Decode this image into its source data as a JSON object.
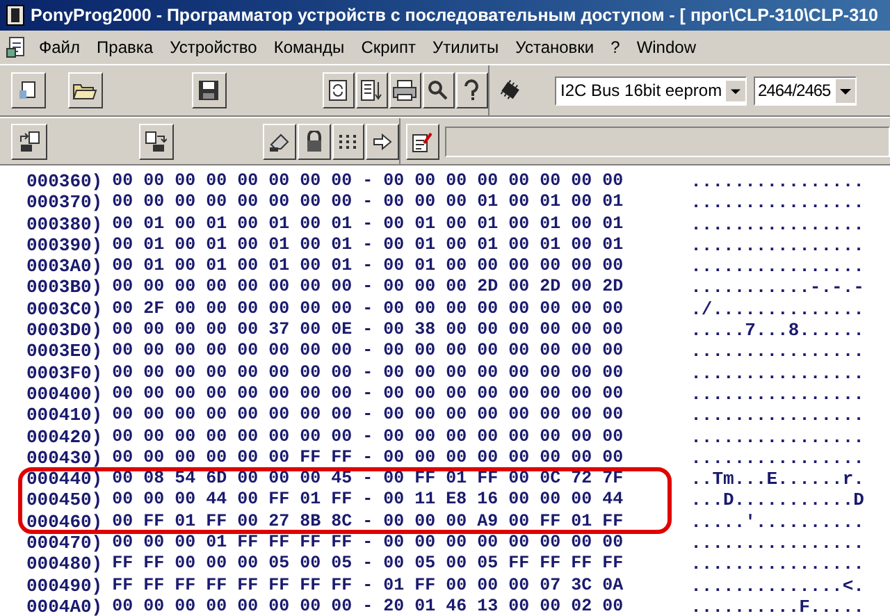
{
  "window": {
    "title": "PonyProg2000 - Программатор устройств с последовательным доступом - [ прог\\CLP-310\\CLP-310"
  },
  "menu": [
    "Файл",
    "Правка",
    "Устройство",
    "Команды",
    "Скрипт",
    "Утилиты",
    "Установки",
    "?",
    "Window"
  ],
  "device_family": "I2C Bus 16bit eeprom",
  "device_type": "2464/2465",
  "rows": [
    {
      "address": "000360)",
      "hex": "00 00 00 00 00 00 00 00 - 00 00 00 00 00 00 00 00",
      "ascii": "................",
      "highlighted": false
    },
    {
      "address": "000370)",
      "hex": "00 00 00 00 00 00 00 00 - 00 00 00 01 00 01 00 01",
      "ascii": "................",
      "highlighted": false
    },
    {
      "address": "000380)",
      "hex": "00 01 00 01 00 01 00 01 - 00 01 00 01 00 01 00 01",
      "ascii": "................",
      "highlighted": false
    },
    {
      "address": "000390)",
      "hex": "00 01 00 01 00 01 00 01 - 00 01 00 01 00 01 00 01",
      "ascii": "................",
      "highlighted": false
    },
    {
      "address": "0003A0)",
      "hex": "00 01 00 01 00 01 00 01 - 00 01 00 00 00 00 00 00",
      "ascii": "................",
      "highlighted": false
    },
    {
      "address": "0003B0)",
      "hex": "00 00 00 00 00 00 00 00 - 00 00 00 2D 00 2D 00 2D",
      "ascii": "...........-.-.-",
      "highlighted": false
    },
    {
      "address": "0003C0)",
      "hex": "00 2F 00 00 00 00 00 00 - 00 00 00 00 00 00 00 00",
      "ascii": "./..............",
      "highlighted": false
    },
    {
      "address": "0003D0)",
      "hex": "00 00 00 00 00 37 00 0E - 00 38 00 00 00 00 00 00",
      "ascii": ".....7...8......",
      "highlighted": false
    },
    {
      "address": "0003E0)",
      "hex": "00 00 00 00 00 00 00 00 - 00 00 00 00 00 00 00 00",
      "ascii": "................",
      "highlighted": false
    },
    {
      "address": "0003F0)",
      "hex": "00 00 00 00 00 00 00 00 - 00 00 00 00 00 00 00 00",
      "ascii": "................",
      "highlighted": false
    },
    {
      "address": "000400)",
      "hex": "00 00 00 00 00 00 00 00 - 00 00 00 00 00 00 00 00",
      "ascii": "................",
      "highlighted": false
    },
    {
      "address": "000410)",
      "hex": "00 00 00 00 00 00 00 00 - 00 00 00 00 00 00 00 00",
      "ascii": "................",
      "highlighted": false
    },
    {
      "address": "000420)",
      "hex": "00 00 00 00 00 00 00 00 - 00 00 00 00 00 00 00 00",
      "ascii": "................",
      "highlighted": false
    },
    {
      "address": "000430)",
      "hex": "00 00 00 00 00 00 FF FF - 00 00 00 00 00 00 00 00",
      "ascii": "................",
      "highlighted": false
    },
    {
      "address": "000440)",
      "hex": "00 08 54 6D 00 00 00 45 - 00 FF 01 FF 00 0C 72 7F",
      "ascii": "..Tm...E......r.",
      "highlighted": true
    },
    {
      "address": "000450)",
      "hex": "00 00 00 44 00 FF 01 FF - 00 11 E8 16 00 00 00 44",
      "ascii": "...D...........D",
      "highlighted": true
    },
    {
      "address": "000460)",
      "hex": "00 FF 01 FF 00 27 8B 8C - 00 00 00 A9 00 FF 01 FF",
      "ascii": ".....'..........",
      "highlighted": true
    },
    {
      "address": "000470)",
      "hex": "00 00 00 01 FF FF FF FF - 00 00 00 00 00 00 00 00",
      "ascii": "................",
      "highlighted": false
    },
    {
      "address": "000480)",
      "hex": "FF FF 00 00 00 05 00 05 - 00 05 00 05 FF FF FF FF",
      "ascii": "................",
      "highlighted": false
    },
    {
      "address": "000490)",
      "hex": "FF FF FF FF FF FF FF FF - 01 FF 00 00 00 07 3C 0A",
      "ascii": "..............<.",
      "highlighted": false
    },
    {
      "address": "0004A0)",
      "hex": "00 00 00 00 00 00 00 00 - 20 01 46 13 00 00 02 00",
      "ascii": "..........F.....",
      "highlighted": false
    }
  ]
}
